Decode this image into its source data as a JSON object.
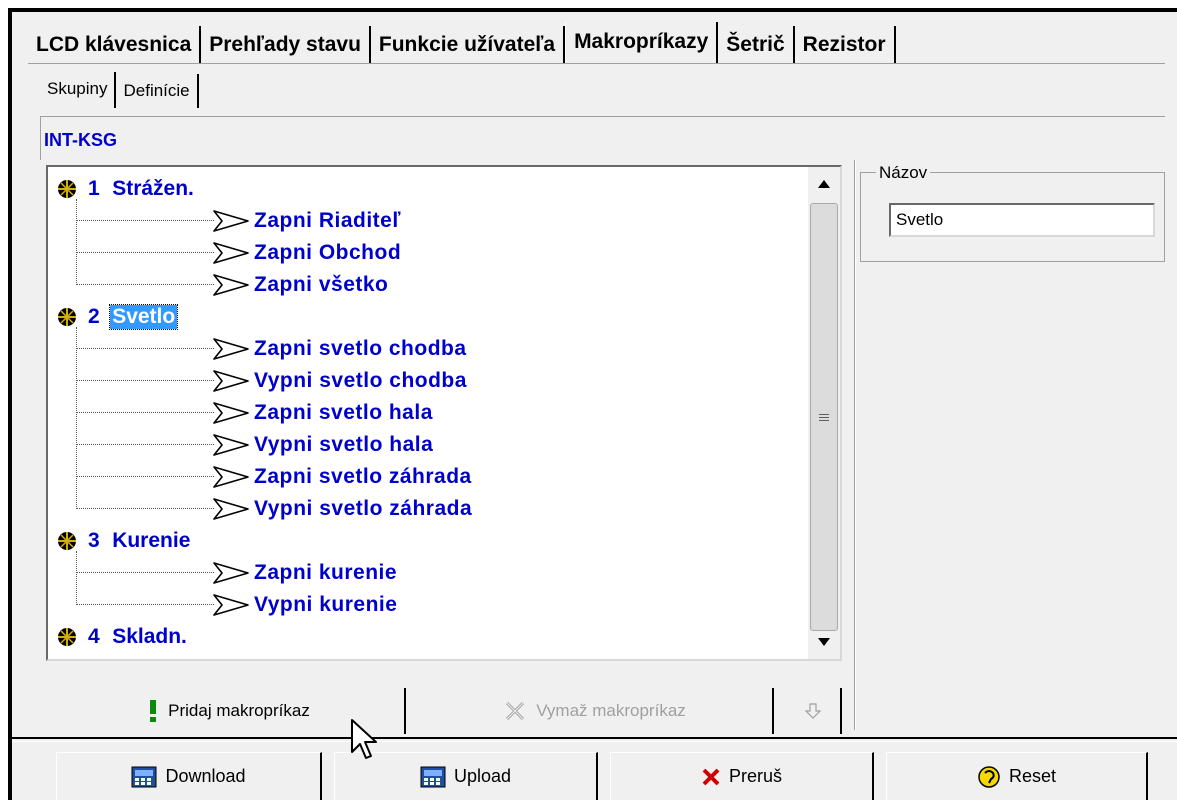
{
  "tabs": {
    "main": [
      "LCD klávesnica",
      "Prehľady stavu",
      "Funkcie užívateľa",
      "Makropríkazy",
      "Šetrič",
      "Rezistor"
    ],
    "sub": [
      "Skupiny",
      "Definície"
    ]
  },
  "panel": {
    "title": "INT-KSG"
  },
  "tree": {
    "groups": [
      {
        "num": "1",
        "name": "Strážen.",
        "items": [
          "Zapni Riaditeľ",
          "Zapni Obchod",
          "Zapni všetko"
        ]
      },
      {
        "num": "2",
        "name": "Svetlo",
        "items": [
          "Zapni svetlo chodba",
          "Vypni svetlo chodba",
          "Zapni svetlo hala",
          "Vypni svetlo hala",
          "Zapni svetlo záhrada",
          "Vypni svetlo záhrada"
        ]
      },
      {
        "num": "3",
        "name": "Kurenie",
        "items": [
          "Zapni kurenie",
          "Vypni kurenie"
        ]
      },
      {
        "num": "4",
        "name": "Skladn.",
        "items": []
      }
    ]
  },
  "name_field": {
    "label": "Názov",
    "value": "Svetlo"
  },
  "tree_buttons": {
    "add": "Pridaj makropríkaz",
    "delete": "Vymaž makropríkaz"
  },
  "bottom_buttons": {
    "download": "Download",
    "upload": "Upload",
    "abort": "Preruš",
    "reset": "Reset"
  },
  "colors": {
    "accent_text": "#0000cc",
    "selection": "#3399ff",
    "background": "#f0f0f0"
  }
}
